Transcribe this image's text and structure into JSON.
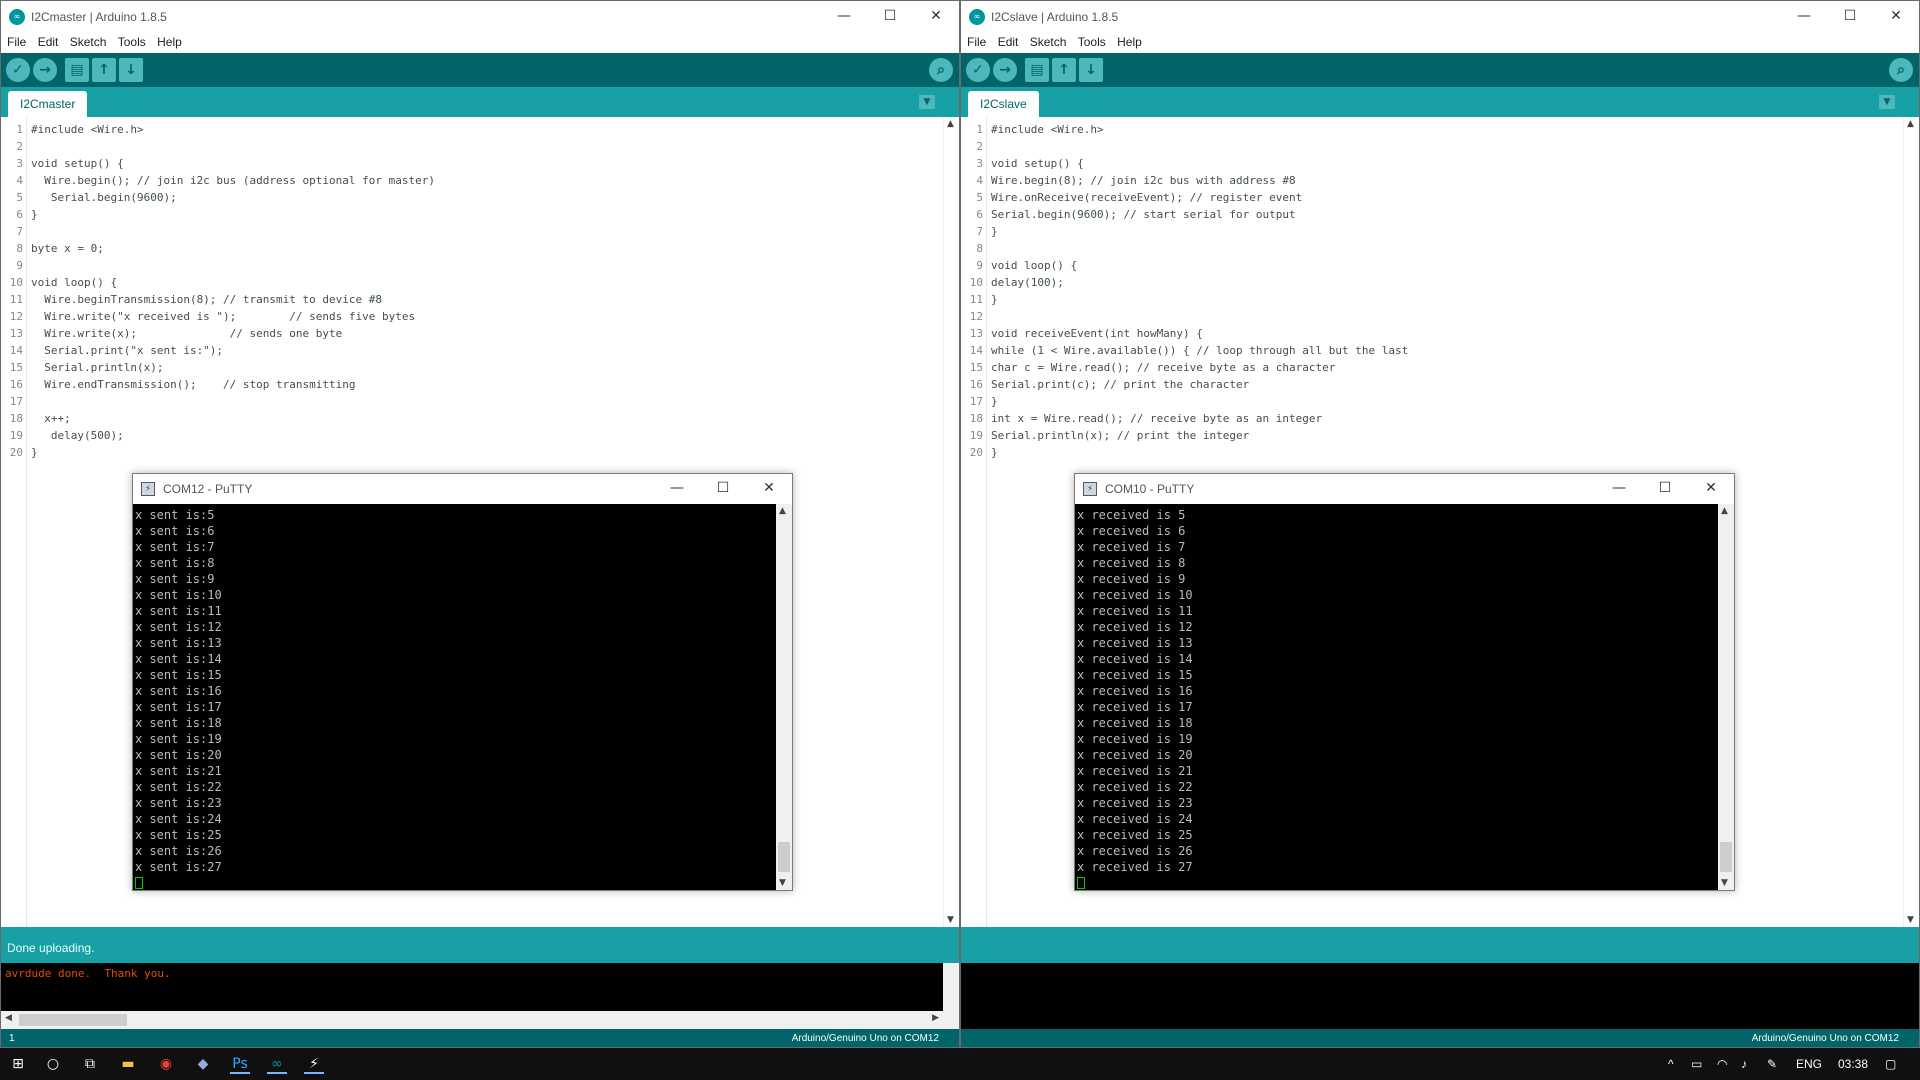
{
  "left_ide": {
    "title": "I2Cmaster | Arduino 1.8.5",
    "menu": [
      "File",
      "Edit",
      "Sketch",
      "Tools",
      "Help"
    ],
    "tab": "I2Cmaster",
    "code": [
      {
        "n": "1",
        "t": "#include <Wire.h>"
      },
      {
        "n": "2",
        "t": ""
      },
      {
        "n": "3",
        "t": "void setup() {"
      },
      {
        "n": "4",
        "t": "  Wire.begin(); // join i2c bus (address optional for master)"
      },
      {
        "n": "5",
        "t": "   Serial.begin(9600);"
      },
      {
        "n": "6",
        "t": "}"
      },
      {
        "n": "7",
        "t": ""
      },
      {
        "n": "8",
        "t": "byte x = 0;"
      },
      {
        "n": "9",
        "t": ""
      },
      {
        "n": "10",
        "t": "void loop() {"
      },
      {
        "n": "11",
        "t": "  Wire.beginTransmission(8); // transmit to device #8"
      },
      {
        "n": "12",
        "t": "  Wire.write(\"x received is \");        // sends five bytes"
      },
      {
        "n": "13",
        "t": "  Wire.write(x);              // sends one byte"
      },
      {
        "n": "14",
        "t": "  Serial.print(\"x sent is:\");"
      },
      {
        "n": "15",
        "t": "  Serial.println(x);"
      },
      {
        "n": "16",
        "t": "  Wire.endTransmission();    // stop transmitting"
      },
      {
        "n": "17",
        "t": ""
      },
      {
        "n": "18",
        "t": "  x++;"
      },
      {
        "n": "19",
        "t": "   delay(500);"
      },
      {
        "n": "20",
        "t": "}"
      }
    ],
    "status": "Done uploading.",
    "console": "avrdude done.  Thank you.",
    "footer_line": "1",
    "footer_board": "Arduino/Genuino Uno on COM12"
  },
  "right_ide": {
    "title": "I2Cslave | Arduino 1.8.5",
    "menu": [
      "File",
      "Edit",
      "Sketch",
      "Tools",
      "Help"
    ],
    "tab": "I2Cslave",
    "code": [
      {
        "n": "1",
        "t": "#include <Wire.h>"
      },
      {
        "n": "2",
        "t": ""
      },
      {
        "n": "3",
        "t": "void setup() {"
      },
      {
        "n": "4",
        "t": "Wire.begin(8); // join i2c bus with address #8"
      },
      {
        "n": "5",
        "t": "Wire.onReceive(receiveEvent); // register event"
      },
      {
        "n": "6",
        "t": "Serial.begin(9600); // start serial for output"
      },
      {
        "n": "7",
        "t": "}"
      },
      {
        "n": "8",
        "t": ""
      },
      {
        "n": "9",
        "t": "void loop() {"
      },
      {
        "n": "10",
        "t": "delay(100);"
      },
      {
        "n": "11",
        "t": "}"
      },
      {
        "n": "12",
        "t": ""
      },
      {
        "n": "13",
        "t": "void receiveEvent(int howMany) {"
      },
      {
        "n": "14",
        "t": "while (1 < Wire.available()) { // loop through all but the last"
      },
      {
        "n": "15",
        "t": "char c = Wire.read(); // receive byte as a character"
      },
      {
        "n": "16",
        "t": "Serial.print(c); // print the character"
      },
      {
        "n": "17",
        "t": "}"
      },
      {
        "n": "18",
        "t": "int x = Wire.read(); // receive byte as an integer"
      },
      {
        "n": "19",
        "t": "Serial.println(x); // print the integer"
      },
      {
        "n": "20",
        "t": "}"
      }
    ],
    "footer_board": "Arduino/Genuino Uno on COM12"
  },
  "putty_left": {
    "title": "COM12 - PuTTY",
    "lines": [
      "x sent is:5",
      "x sent is:6",
      "x sent is:7",
      "x sent is:8",
      "x sent is:9",
      "x sent is:10",
      "x sent is:11",
      "x sent is:12",
      "x sent is:13",
      "x sent is:14",
      "x sent is:15",
      "x sent is:16",
      "x sent is:17",
      "x sent is:18",
      "x sent is:19",
      "x sent is:20",
      "x sent is:21",
      "x sent is:22",
      "x sent is:23",
      "x sent is:24",
      "x sent is:25",
      "x sent is:26",
      "x sent is:27"
    ]
  },
  "putty_right": {
    "title": "COM10 - PuTTY",
    "lines": [
      "x received is 5",
      "x received is 6",
      "x received is 7",
      "x received is 8",
      "x received is 9",
      "x received is 10",
      "x received is 11",
      "x received is 12",
      "x received is 13",
      "x received is 14",
      "x received is 15",
      "x received is 16",
      "x received is 17",
      "x received is 18",
      "x received is 19",
      "x received is 20",
      "x received is 21",
      "x received is 22",
      "x received is 23",
      "x received is 24",
      "x received is 25",
      "x received is 26",
      "x received is 27"
    ]
  },
  "taskbar": {
    "lang": "ENG",
    "time": "03:38"
  },
  "colors": {
    "arduino_teal": "#00979c",
    "arduino_dark": "#006468",
    "tab_bar": "#17a1a5",
    "console_text": "#e34c00"
  }
}
